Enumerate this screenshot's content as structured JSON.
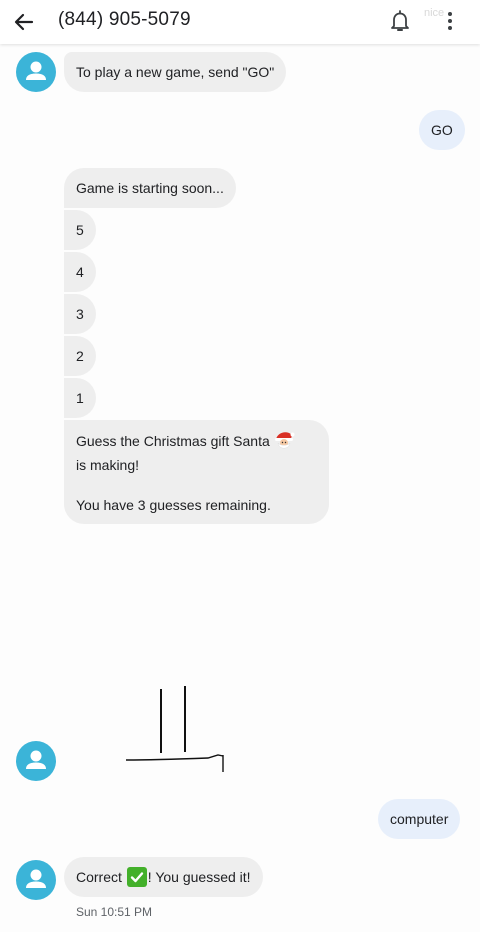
{
  "header": {
    "title": "(844) 905-5079",
    "faint_text": "nice"
  },
  "messages": {
    "m1": "To play a new game, send \"GO\"",
    "m2": "GO",
    "m3": "Game is starting soon...",
    "countdown": [
      "5",
      "4",
      "3",
      "2",
      "1"
    ],
    "m4_line1": "Guess the Christmas gift Santa",
    "m4_line2": "is making!",
    "m4_line3": "You have 3 guesses remaining.",
    "m5": "computer",
    "m6_before": "Correct",
    "m6_after": "! You guessed it!",
    "timestamp": "Sun 10:51 PM"
  },
  "colors": {
    "avatar": "#3bb4d8",
    "incoming_bubble": "#eeeeee",
    "outgoing_bubble": "#e7effb"
  },
  "icons": [
    "back-arrow-icon",
    "notification-bell-icon",
    "more-vert-icon",
    "person-icon",
    "santa-emoji-icon",
    "check-mark-emoji-icon"
  ]
}
